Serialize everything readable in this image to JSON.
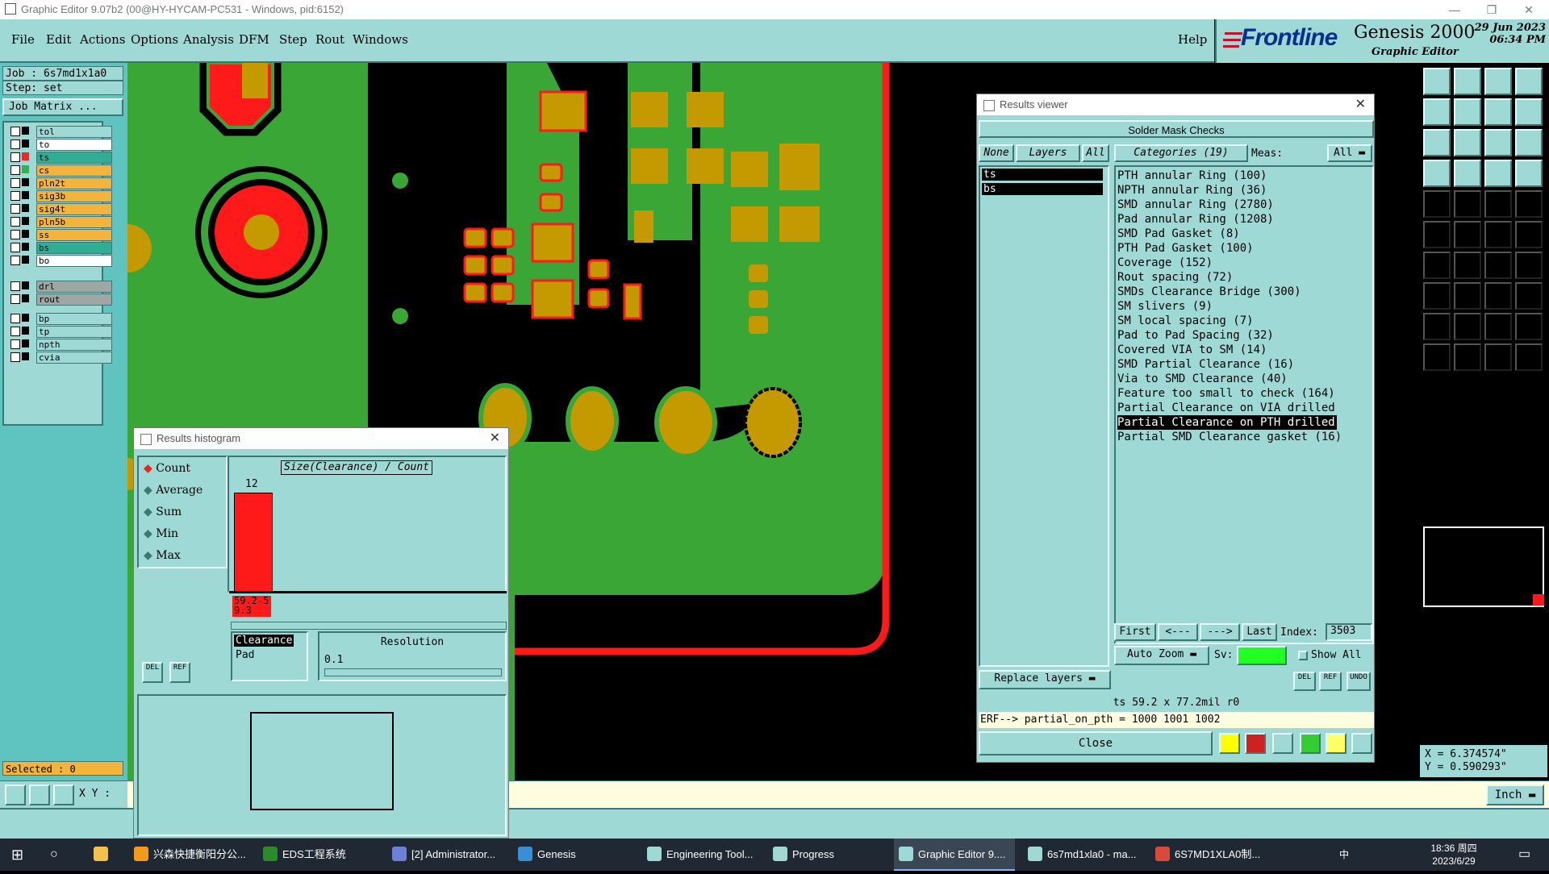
{
  "window": {
    "title": "Graphic Editor 9.07b2 (00@HY-HYCAM-PC531 - Windows, pid:6152)"
  },
  "menu": [
    "File",
    "Edit",
    "Actions",
    "Options",
    "Analysis",
    "DFM",
    "Step",
    "Rout",
    "Windows"
  ],
  "help": "Help",
  "brand": {
    "logo": "Frontline",
    "product": "Genesis 2000",
    "subtitle": "Graphic Editor",
    "date": "29 Jun 2023",
    "time": "06:34 PM"
  },
  "job": {
    "label": "Job : 6s7md1x1a0",
    "step": "Step: set",
    "matrix_btn": "Job Matrix ..."
  },
  "layers": [
    {
      "name": "tol",
      "color": "#9fd9d6",
      "sw": "#000"
    },
    {
      "name": "to",
      "color": "#ffffff",
      "sw": "#000"
    },
    {
      "name": "ts",
      "color": "#2fae94",
      "sw": "#ff2020"
    },
    {
      "name": "cs",
      "color": "#f2b43c",
      "sw": "#36b04a"
    },
    {
      "name": "pln2t",
      "color": "#f2b43c",
      "sw": "#000"
    },
    {
      "name": "sig3b",
      "color": "#f2b43c",
      "sw": "#000"
    },
    {
      "name": "sig4t",
      "color": "#f2b43c",
      "sw": "#000"
    },
    {
      "name": "pln5b",
      "color": "#f2b43c",
      "sw": "#000"
    },
    {
      "name": "ss",
      "color": "#f2b43c",
      "sw": "#000"
    },
    {
      "name": "bs",
      "color": "#2fae94",
      "sw": "#000"
    },
    {
      "name": "bo",
      "color": "#ffffff",
      "sw": "#000"
    }
  ],
  "layers2": [
    {
      "name": "drl",
      "color": "#9ea6a6"
    },
    {
      "name": "rout",
      "color": "#9ea6a6"
    }
  ],
  "layers3": [
    {
      "name": "bp",
      "color": "#9fd9d6"
    },
    {
      "name": "tp",
      "color": "#9fd9d6"
    },
    {
      "name": "npth",
      "color": "#9fd9d6"
    },
    {
      "name": "cvia",
      "color": "#9fd9d6"
    }
  ],
  "selected": "Selected : 0",
  "xy_label": "X Y :",
  "units": "Inch",
  "coords": {
    "x": "X = 6.374574\"",
    "y": "Y = 0.590293\""
  },
  "results_viewer": {
    "title": "Results viewer",
    "header": "Solder Mask Checks",
    "none_btn": "None",
    "layers_btn": "Layers",
    "all_btn": "All",
    "categories_btn": "Categories (19)",
    "meas_label": "Meas:",
    "meas_value": "All",
    "layer_items": [
      "ts",
      "bs"
    ],
    "categories": [
      "PTH annular Ring (100)",
      "NPTH annular Ring (36)",
      "SMD annular Ring (2780)",
      "Pad annular Ring (1208)",
      "SMD Pad Gasket (8)",
      "PTH Pad Gasket (100)",
      "Coverage (152)",
      "Rout spacing (72)",
      "SMDs Clearance Bridge (300)",
      "SM slivers (9)",
      "SM local spacing (7)",
      "Pad to Pad Spacing (32)",
      "Covered VIA to SM (14)",
      "SMD Partial Clearance (16)",
      "Via to SMD Clearance (40)",
      "Feature too small to check (164)",
      "Partial Clearance on VIA drilled",
      "Partial Clearance on PTH drilled",
      "Partial SMD Clearance gasket (16)"
    ],
    "selected_index": 17,
    "first": "First",
    "prev": "<---",
    "next": "--->",
    "last": "Last",
    "index_label": "Index:",
    "index_value": "3503",
    "auto_zoom": "Auto Zoom",
    "sv_label": "Sv:",
    "show_all": "Show All",
    "replace_layers": "Replace layers",
    "status": "ts 59.2 x 77.2mil r0",
    "erf": "ERF--> partial_on_pth = 1000 1001 1002",
    "close": "Close"
  },
  "histogram": {
    "title": "Results histogram",
    "options": [
      "Count",
      "Average",
      "Sum",
      "Min",
      "Max"
    ],
    "selected_option": 0,
    "axis_title": "Size(Clearance) / Count",
    "bar_value": "12",
    "bar_label": "59.2-59.3",
    "list_items": [
      "Clearance",
      "Pad"
    ],
    "resolution_label": "Resolution",
    "resolution_value": "0.1",
    "del": "DEL",
    "ref": "REF"
  },
  "taskbar": {
    "items": [
      "兴森快捷衡阳分公...",
      "EDS工程系统",
      "[2] Administrator...",
      "Genesis",
      "Engineering Tool...",
      "Progress",
      "Graphic Editor 9....",
      "6s7md1xla0 - ma...",
      "6S7MD1XLA0制..."
    ],
    "time": "18:36 周四",
    "date": "2023/6/29",
    "ime": "中"
  }
}
